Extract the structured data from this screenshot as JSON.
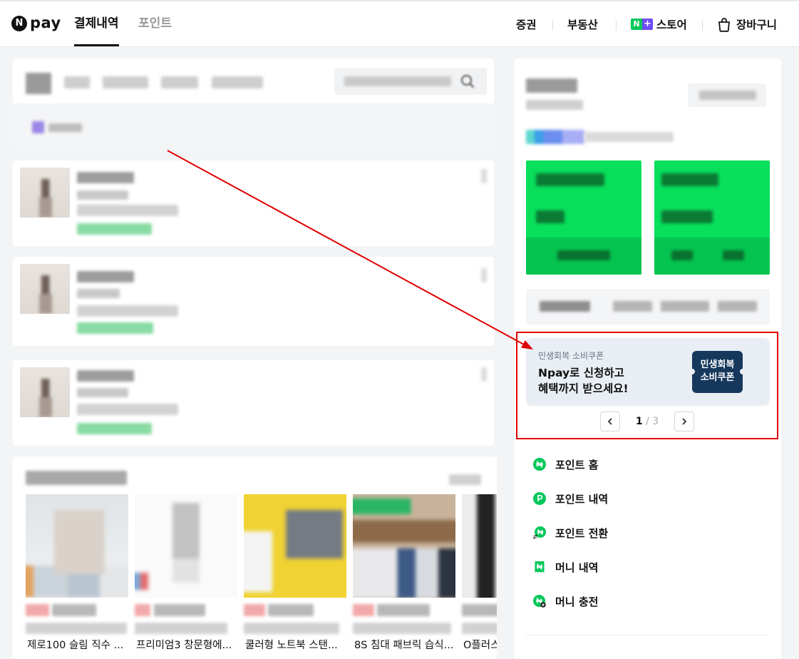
{
  "header": {
    "logo": {
      "mark": "N",
      "text": "pay"
    },
    "tabs": [
      {
        "label": "결제내역",
        "active": true
      },
      {
        "label": "포인트",
        "active": false
      }
    ],
    "links": {
      "securities": "증권",
      "real_estate": "부동산",
      "store": {
        "badge_n": "N",
        "badge_plus": "+",
        "label": "스토어"
      },
      "cart": {
        "label": "장바구니",
        "icon": "cart-icon"
      }
    }
  },
  "recommend": {
    "products": [
      {
        "name": "제로100 슬림 직수 ..."
      },
      {
        "name": "프리미엄3 창문형에..."
      },
      {
        "name": "쿨러형 노트북 스탠..."
      },
      {
        "name": "8S 침대 패브릭 습식..."
      },
      {
        "name": "O플러스"
      }
    ]
  },
  "promo": {
    "eyebrow": "민생회복 소비쿠폰",
    "title": [
      "Npay로 신청하고",
      "혜택까지 받으세요!"
    ],
    "badge": [
      "민생회복",
      "소비쿠폰"
    ],
    "pagination": {
      "current": "1",
      "separator": "/",
      "total": "3",
      "prev_icon": "chevron-left-icon",
      "next_icon": "chevron-right-icon"
    }
  },
  "side_menu": [
    {
      "label": "포인트 홈",
      "icon": "point-home-icon"
    },
    {
      "label": "포인트 내역",
      "icon": "point-history-icon"
    },
    {
      "label": "포인트 전환",
      "icon": "point-convert-icon"
    },
    {
      "label": "머니 내역",
      "icon": "money-history-icon"
    },
    {
      "label": "머니 충전",
      "icon": "money-charge-icon"
    }
  ],
  "colors": {
    "brand_green": "#03c75a",
    "store_purple": "#6f4cf5",
    "coupon_navy": "#16385c",
    "promo_background": "#e8eef4",
    "annotation_red": "#e00000"
  }
}
